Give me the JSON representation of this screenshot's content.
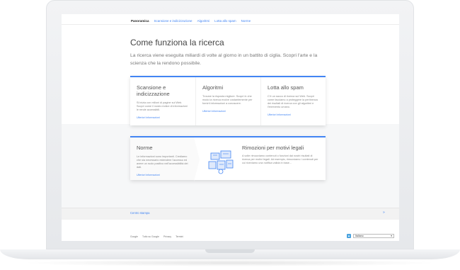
{
  "nav": {
    "items": [
      "Panoramica",
      "Scansione e indicizzazione",
      "Algoritmi",
      "Lotta allo spam",
      "Norme"
    ]
  },
  "main": {
    "title": "Come funziona la ricerca",
    "intro": "La ricerca viene eseguita miliardi di volte al giorno in un battito di ciglia. Scopri l'arte e la scienza che la rendono possibile."
  },
  "cards": {
    "crawling": {
      "title": "Scansione e indicizzazione",
      "desc": "Si inizia con milioni di pagine sul Web. Scopri come il nostro indice di informazioni le rende accessibili.",
      "link": "Ulteriori informazioni"
    },
    "algorithms": {
      "title": "Algoritmi",
      "desc": "Trovare la risposta migliore. Scopri in che modo la ricerca evolve costantemente per fornirti informazioni a conoscere.",
      "link": "Ulteriori informazioni"
    },
    "spam": {
      "title": "Lotta allo spam",
      "desc": "C'è un sacco di ricerca sul Web. Scopri come facciamo a proteggere la pertinenza dei risultati di ricerca con gli algoritmi e l'intervento umano.",
      "link": "Ulteriori informazioni"
    },
    "policies": {
      "title": "Norme",
      "desc": "Le informazioni sono importanti. Crediamo che sia necessario estendere l'accesso ed avere un ruolo positivo nell'accessibilità dei dati.",
      "link": "Ulteriori informazioni"
    },
    "removals": {
      "title": "Rimozioni per motivi legali",
      "desc": "A volte rimuoviamo contenuti o funzioni dai nostri risultati di ricerca per motivi legali. Ad esempio, rimuoviamo i contenuti per cui riceviamo una notifica valida in base..."
    }
  },
  "footer": {
    "press": "Centro stampa",
    "arrow": "»",
    "links": [
      "Google",
      "Tutto su Google",
      "Privacy",
      "Termini"
    ],
    "language": "Italiano",
    "language_caret": "▾"
  },
  "colors": {
    "accent": "#4285f4",
    "frame": "#e8eaed",
    "band": "#f6f7f8"
  }
}
